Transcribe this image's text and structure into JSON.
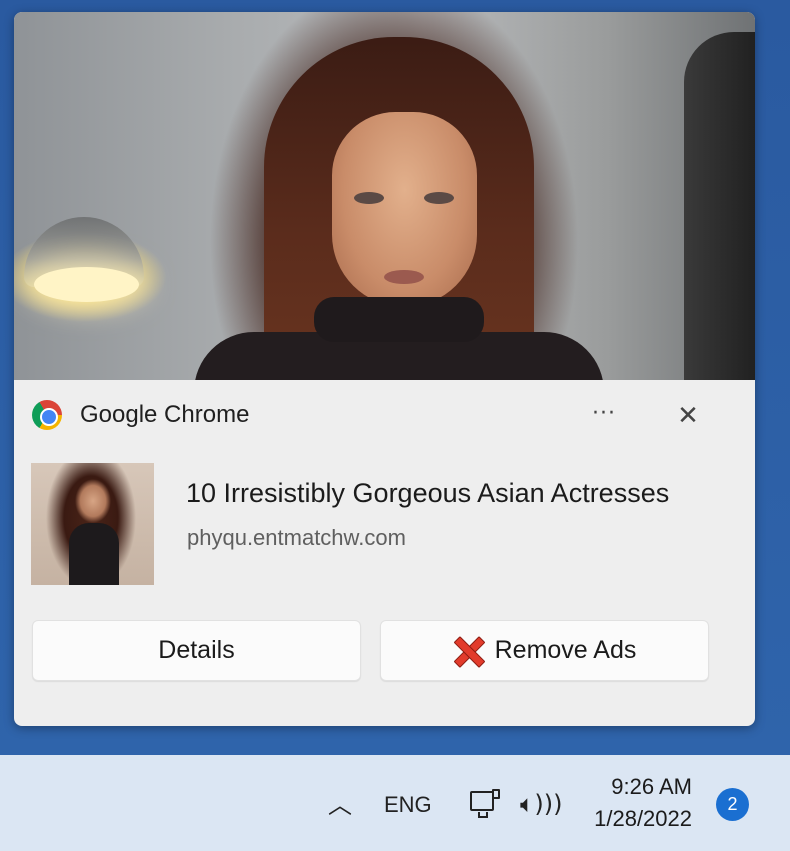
{
  "notification": {
    "app_name": "Google Chrome",
    "app_icon": "chrome-icon",
    "more_label": "···",
    "close_label": "✕",
    "title": "10 Irresistibly Gorgeous Asian Actresses",
    "source": "phyqu.entmatchw.com",
    "buttons": {
      "details_label": "Details",
      "remove_label": "Remove Ads",
      "remove_icon": "red-x-icon"
    }
  },
  "taskbar": {
    "chevron": "︿",
    "language": "ENG",
    "network_icon": "network-icon",
    "volume_icon": "volume-icon",
    "time": "9:26 AM",
    "date": "1/28/2022",
    "notification_count": "2"
  },
  "colors": {
    "desktop": "#2f5fa3",
    "toast_bg": "#eeeeee",
    "taskbar_bg": "#dbe6f3",
    "badge": "#1a6fd1",
    "remove_x": "#e23b2b"
  }
}
